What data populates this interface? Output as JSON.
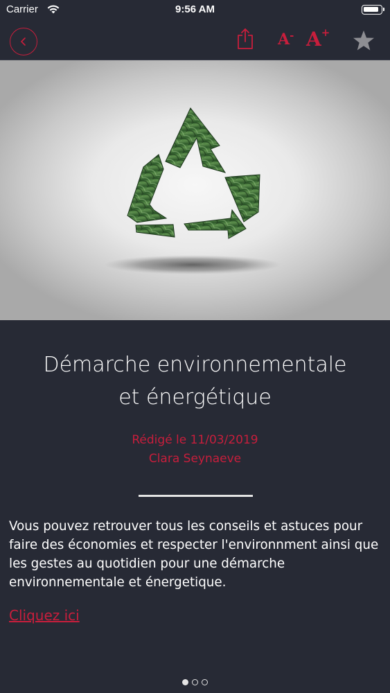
{
  "status_bar": {
    "carrier": "Carrier",
    "time": "9:56 AM"
  },
  "toolbar": {
    "font_smaller_label": "A",
    "font_smaller_suffix": "-",
    "font_larger_label": "A",
    "font_larger_suffix": "+"
  },
  "article": {
    "title_line1": "Démarche environnementale",
    "title_line2": "et énergétique",
    "date": "Rédigé le 11/03/2019",
    "author": "Clara Seynaeve",
    "body": "Vous pouvez retrouver tous les conseils et astuces pour faire des économies et respecter l'environnment ainsi que les gestes au quotidien pour une démarche environnementale et énergetique.",
    "link_label": "Cliquez ici"
  },
  "pagination": {
    "current_page": 1,
    "total_pages": 3
  },
  "colors": {
    "accent": "#c81e3c",
    "background": "#272a35",
    "text": "#ffffff",
    "star_inactive": "#8e8e93"
  },
  "icons": {
    "back": "chevron-left-icon",
    "share": "share-icon",
    "favorite": "star-icon",
    "wifi": "wifi-icon",
    "battery": "battery-icon"
  }
}
